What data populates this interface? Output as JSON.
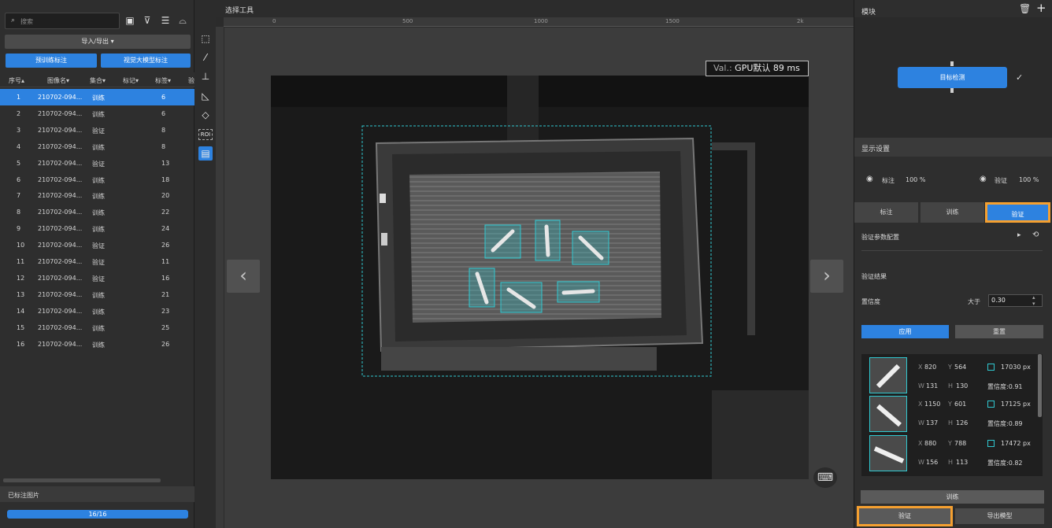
{
  "left": {
    "search": {
      "placeholder": "搜索"
    },
    "import_export": "导入/导出 ▾",
    "btn_pretrain": "预训练标注",
    "btn_vision_model": "视觉大模型标注",
    "columns": [
      "序号▴",
      "图像名▾",
      "集合▾",
      "标记▾",
      "标签▾",
      "验"
    ],
    "rows": [
      {
        "idx": "1",
        "name": "210702-094...",
        "set": "训练",
        "label": "6"
      },
      {
        "idx": "2",
        "name": "210702-094...",
        "set": "训练",
        "label": "6"
      },
      {
        "idx": "3",
        "name": "210702-094...",
        "set": "验证",
        "label": "8"
      },
      {
        "idx": "4",
        "name": "210702-094...",
        "set": "训练",
        "label": "8"
      },
      {
        "idx": "5",
        "name": "210702-094...",
        "set": "验证",
        "label": "13"
      },
      {
        "idx": "6",
        "name": "210702-094...",
        "set": "训练",
        "label": "18"
      },
      {
        "idx": "7",
        "name": "210702-094...",
        "set": "训练",
        "label": "20"
      },
      {
        "idx": "8",
        "name": "210702-094...",
        "set": "训练",
        "label": "22"
      },
      {
        "idx": "9",
        "name": "210702-094...",
        "set": "训练",
        "label": "24"
      },
      {
        "idx": "10",
        "name": "210702-094...",
        "set": "验证",
        "label": "26"
      },
      {
        "idx": "11",
        "name": "210702-094...",
        "set": "验证",
        "label": "11"
      },
      {
        "idx": "12",
        "name": "210702-094...",
        "set": "验证",
        "label": "16"
      },
      {
        "idx": "13",
        "name": "210702-094...",
        "set": "训练",
        "label": "21"
      },
      {
        "idx": "14",
        "name": "210702-094...",
        "set": "训练",
        "label": "23"
      },
      {
        "idx": "15",
        "name": "210702-094...",
        "set": "训练",
        "label": "25"
      },
      {
        "idx": "16",
        "name": "210702-094...",
        "set": "训练",
        "label": "26"
      }
    ],
    "labeled_title": "已标注图片",
    "progress_text": "16/16",
    "progress_fraction": 1.0
  },
  "center": {
    "title": "选择工具",
    "ruler_top": [
      "0",
      "500",
      "1000",
      "1500",
      "2k"
    ],
    "val_label": "Val.:",
    "val_text": "GPU默认 89 ms",
    "roi_label": "ROI"
  },
  "right": {
    "module_title": "模块",
    "detect_label": "目标检测",
    "display_title": "显示设置",
    "label_vis": "标注",
    "label_pct": "100 %",
    "verify_vis": "验证",
    "verify_pct": "100 %",
    "tabs": [
      "标注",
      "训练",
      "验证"
    ],
    "verify_params": "验证参数配置",
    "verify_results": "验证结果",
    "confidence": "置信度",
    "greater": "大于",
    "threshold": "0.30",
    "apply": "应用",
    "reset": "重置",
    "results": [
      {
        "x": "820",
        "y": "564",
        "w": "131",
        "h": "130",
        "area": "17030 px",
        "conf": "置信度:0.91"
      },
      {
        "x": "1150",
        "y": "601",
        "w": "137",
        "h": "126",
        "area": "17125 px",
        "conf": "置信度:0.89"
      },
      {
        "x": "880",
        "y": "788",
        "w": "156",
        "h": "113",
        "area": "17472 px",
        "conf": "置信度:0.82"
      }
    ],
    "train": "训练",
    "verify": "验证",
    "export": "导出模型"
  },
  "colors": {
    "accent": "#2d82e0",
    "highlight": "#f5a030",
    "bbox": "#30c8d0"
  }
}
